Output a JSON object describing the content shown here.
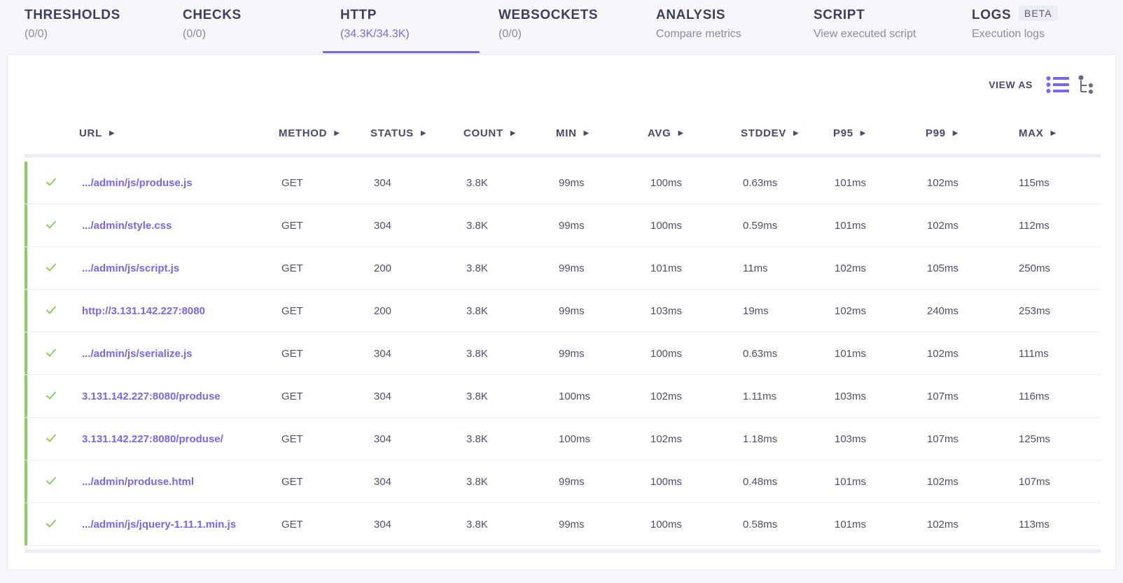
{
  "tabs": [
    {
      "title": "THRESHOLDS",
      "sub": "(0/0)"
    },
    {
      "title": "CHECKS",
      "sub": "(0/0)"
    },
    {
      "title": "HTTP",
      "sub": "(34.3K/34.3K)"
    },
    {
      "title": "WEBSOCKETS",
      "sub": "(0/0)"
    },
    {
      "title": "ANALYSIS",
      "sub": "Compare metrics"
    },
    {
      "title": "SCRIPT",
      "sub": "View executed script"
    },
    {
      "title": "LOGS",
      "sub": "Execution logs",
      "badge": "BETA"
    }
  ],
  "active_tab": "HTTP",
  "view_as_label": "VIEW AS",
  "columns": [
    "URL",
    "METHOD",
    "STATUS",
    "COUNT",
    "MIN",
    "AVG",
    "STDDEV",
    "P95",
    "P99",
    "MAX"
  ],
  "rows": [
    {
      "url": ".../admin/js/produse.js",
      "method": "GET",
      "status": "304",
      "count": "3.8K",
      "min": "99ms",
      "avg": "100ms",
      "stddev": "0.63ms",
      "p95": "101ms",
      "p99": "102ms",
      "max": "115ms"
    },
    {
      "url": ".../admin/style.css",
      "method": "GET",
      "status": "304",
      "count": "3.8K",
      "min": "99ms",
      "avg": "100ms",
      "stddev": "0.59ms",
      "p95": "101ms",
      "p99": "102ms",
      "max": "112ms"
    },
    {
      "url": ".../admin/js/script.js",
      "method": "GET",
      "status": "200",
      "count": "3.8K",
      "min": "99ms",
      "avg": "101ms",
      "stddev": "11ms",
      "p95": "102ms",
      "p99": "105ms",
      "max": "250ms"
    },
    {
      "url": "http://3.131.142.227:8080",
      "method": "GET",
      "status": "200",
      "count": "3.8K",
      "min": "99ms",
      "avg": "103ms",
      "stddev": "19ms",
      "p95": "102ms",
      "p99": "240ms",
      "max": "253ms"
    },
    {
      "url": ".../admin/js/serialize.js",
      "method": "GET",
      "status": "304",
      "count": "3.8K",
      "min": "99ms",
      "avg": "100ms",
      "stddev": "0.63ms",
      "p95": "101ms",
      "p99": "102ms",
      "max": "111ms"
    },
    {
      "url": "3.131.142.227:8080/produse",
      "method": "GET",
      "status": "304",
      "count": "3.8K",
      "min": "100ms",
      "avg": "102ms",
      "stddev": "1.11ms",
      "p95": "103ms",
      "p99": "107ms",
      "max": "116ms"
    },
    {
      "url": "3.131.142.227:8080/produse/",
      "method": "GET",
      "status": "304",
      "count": "3.8K",
      "min": "100ms",
      "avg": "102ms",
      "stddev": "1.18ms",
      "p95": "103ms",
      "p99": "107ms",
      "max": "125ms"
    },
    {
      "url": ".../admin/produse.html",
      "method": "GET",
      "status": "304",
      "count": "3.8K",
      "min": "99ms",
      "avg": "100ms",
      "stddev": "0.48ms",
      "p95": "101ms",
      "p99": "102ms",
      "max": "107ms"
    },
    {
      "url": ".../admin/js/jquery-1.11.1.min.js",
      "method": "GET",
      "status": "304",
      "count": "3.8K",
      "min": "99ms",
      "avg": "100ms",
      "stddev": "0.58ms",
      "p95": "101ms",
      "p99": "102ms",
      "max": "113ms"
    }
  ],
  "colors": {
    "accent": "#7d64f0",
    "success": "#8fca63"
  },
  "icons": {
    "row_status": "check-icon",
    "view_list": "list-view-icon",
    "view_tree": "tree-view-icon",
    "sort": "sort-caret-icon"
  }
}
